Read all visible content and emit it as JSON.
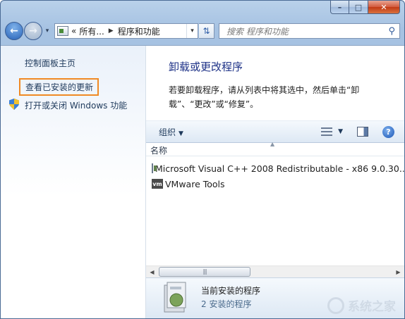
{
  "window": {
    "caption": {
      "minimize": "–",
      "maximize": "□",
      "close": "✕"
    }
  },
  "navbar": {
    "back_glyph": "←",
    "forward_glyph": "→",
    "address": {
      "prefix": "«",
      "crumb1": "所有...",
      "separator": "▶",
      "crumb2": "程序和功能"
    },
    "search_placeholder": "搜索 程序和功能"
  },
  "left_pane": {
    "home_link": "控制面板主页",
    "updates_link": "查看已安装的更新",
    "features_link": "打开或关闭 Windows 功能"
  },
  "main": {
    "title": "卸载或更改程序",
    "description": "若要卸载程序，请从列表中将其选中，然后单击“卸载”、“更改”或“修复”。"
  },
  "toolbar": {
    "organize_label": "组织"
  },
  "list": {
    "column_name": "名称",
    "items": [
      {
        "name": "Microsoft Visual C++ 2008 Redistributable - x86 9.0.30...",
        "icon": "program-icon"
      },
      {
        "name": "VMware Tools",
        "icon": "vmware-icon",
        "icon_text": "vm"
      }
    ]
  },
  "scrollbar": {
    "thumb_grip": "|||"
  },
  "details": {
    "title": "当前安装的程序",
    "subtitle": "2 安装的程序"
  },
  "watermark": {
    "text": "系统之家"
  }
}
